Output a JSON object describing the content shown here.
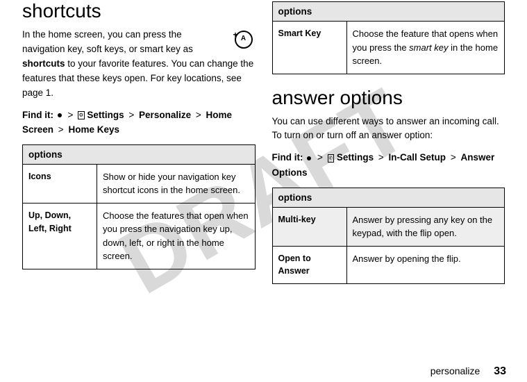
{
  "watermark": "DRAFT",
  "left": {
    "heading": "shortcuts",
    "para1a": "In the home screen, you can press the navigation key, soft keys, or smart key as ",
    "para1b": "shortcuts",
    "para1c": " to your favorite features. You can change the features that these keys open. For key locations, see page 1.",
    "findit_label": "Find it:",
    "path_settings": "Settings",
    "path_personalize": "Personalize",
    "path_homescreen": "Home Screen",
    "path_homekeys": "Home Keys",
    "table_header": "options",
    "rows": [
      {
        "label": "Icons",
        "desc": "Show or hide your navigation key shortcut icons in the home screen."
      },
      {
        "label": "Up, Down, Left, Right",
        "desc": "Choose the features that open when you press the navigation key up, down, left, or right in the home screen."
      }
    ]
  },
  "right": {
    "top_table_header": "options",
    "top_rows": [
      {
        "label": "Smart Key",
        "desc_a": "Choose the feature that opens when you press the ",
        "desc_em": "smart key",
        "desc_b": " in the home screen."
      }
    ],
    "heading": "answer options",
    "para": "You can use different ways to answer an incoming call. To turn on or turn off an answer option:",
    "findit_label": "Find it:",
    "path_settings": "Settings",
    "path_incall": "In-Call Setup",
    "path_answer": "Answer Options",
    "table_header": "options",
    "rows": [
      {
        "label": "Multi-key",
        "desc": "Answer by pressing any key on the keypad, with the flip open.",
        "gray": true
      },
      {
        "label": "Open to Answer",
        "desc": "Answer by opening the flip.",
        "gray": false
      }
    ]
  },
  "footer_text": "personalize",
  "footer_page": "33"
}
